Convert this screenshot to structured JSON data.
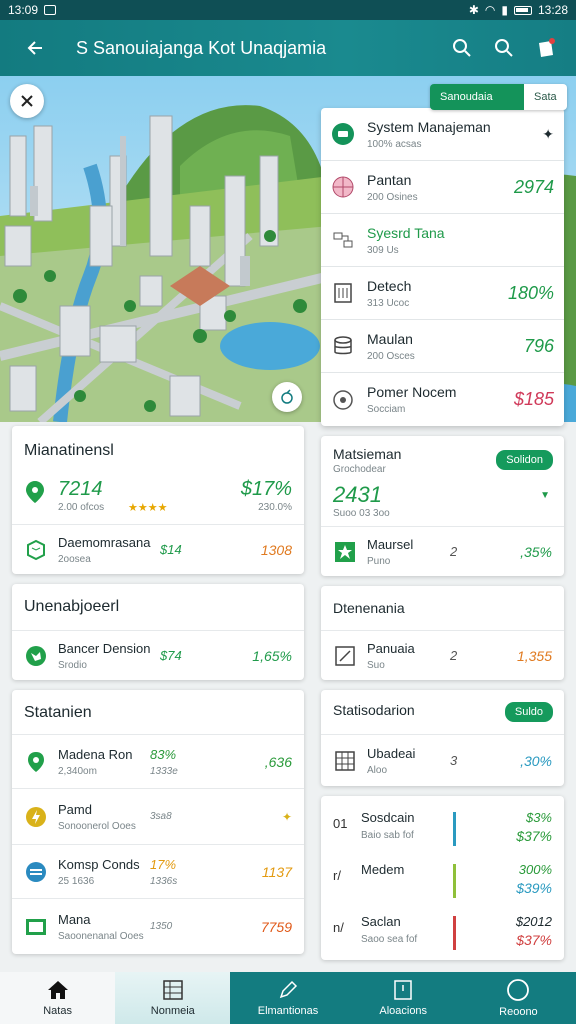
{
  "status": {
    "time": "13:09",
    "time_right": "13:28"
  },
  "appbar": {
    "title": "S Sanouiajanga Kot Unaqjamia"
  },
  "map": {
    "toggle_on": "Sanoudaia",
    "toggle_off": "Sata"
  },
  "side_panel": {
    "header": {
      "title": "System Manajeman",
      "sub": "100% acsas"
    },
    "items": [
      {
        "label": "Pantan",
        "sub": "200 Osines",
        "value": "2974",
        "color": "#1f9a4a"
      },
      {
        "label": "Syesrd Tana",
        "sub": "309 Us",
        "value": "",
        "color": "#1f9a4a"
      },
      {
        "label": "Detech",
        "sub": "313 Ucoc",
        "value": "180%",
        "color": "#1f9a4a"
      },
      {
        "label": "Maulan",
        "sub": "200 Osces",
        "value": "796",
        "color": "#1f9a4a"
      },
      {
        "label": "Pomer Nocem",
        "sub": "Socciam",
        "value": "$185",
        "color": "#d03a5a"
      }
    ]
  },
  "card_management": {
    "title": "Mianatinensl",
    "top": {
      "value": "7214",
      "sub": "2.00 ofcos",
      "right_value": "$17%",
      "right_sub": "230.0%"
    },
    "row": {
      "label": "Daemomrasana",
      "sub": "2oosea",
      "mid": "$14",
      "value": "1308"
    }
  },
  "card_matsieman": {
    "title": "Matsieman",
    "sub": "Grochodear",
    "pill": "Solidon",
    "big_value": "2431",
    "big_sub": "Suoo 03 3oo",
    "row": {
      "label": "Maursel",
      "sub": "Puno",
      "mid": "2",
      "value": ",35%"
    }
  },
  "card_unenab": {
    "title": "Unenabjoeerl",
    "row": {
      "label": "Bancer Dension",
      "sub": "Srodio",
      "mid": "$74",
      "value": "1,65%"
    }
  },
  "card_dtenenania": {
    "title": "Dtenenania",
    "row": {
      "label": "Panuaia",
      "sub": "Suo",
      "mid": "2",
      "value": "1,355"
    }
  },
  "card_statanien": {
    "title": "Statanien",
    "rows": [
      {
        "label": "Madena Ron",
        "sub": "2,340om",
        "mid": "83%",
        "mid_sub": "1333e",
        "value": ",636",
        "mid_color": "#2a9a3a",
        "value_color": "#2a9a3a"
      },
      {
        "label": "Pamd",
        "sub": "Sonoonerol Ooes",
        "mid": "",
        "mid_sub": "3sa8",
        "value": "",
        "mid_color": "#7a8589",
        "value_color": "#7a8589"
      },
      {
        "label": "Komsp Conds",
        "sub": "25 1636",
        "mid": "17%",
        "mid_sub": "1336s",
        "value": "1137",
        "mid_color": "#e39a10",
        "value_color": "#e39a10"
      },
      {
        "label": "Mana",
        "sub": "Saoonenanal Ooes",
        "mid": "",
        "mid_sub": "1350",
        "value": "7759",
        "mid_color": "#7a8589",
        "value_color": "#e05a1a"
      }
    ]
  },
  "card_statisodarion": {
    "title": "Statisodarion",
    "pill": "Suldo",
    "row": {
      "label": "Ubadeai",
      "sub": "Aloo",
      "mid": "3",
      "value": ",30%"
    }
  },
  "card_rank": {
    "rows": [
      {
        "num": "01",
        "label": "Sosdcain",
        "sub": "Baio sab fof",
        "v1": "$3%",
        "v2": "$37%",
        "c1": "#2a9a3a",
        "c2": "#2a9a3a",
        "bar": "#2a9ac0"
      },
      {
        "num": "r/",
        "label": "Medem",
        "sub": "",
        "v1": "300%",
        "v2": "$39%",
        "c1": "#2a9a3a",
        "c2": "#2a9ac0",
        "bar": "#8fc03a"
      },
      {
        "num": "n/",
        "label": "Saclan",
        "sub": "Saoo sea fof",
        "v1": "$2012",
        "v2": "$37%",
        "c1": "#1d2a2f",
        "c2": "#d04040",
        "bar": "#d04040"
      }
    ]
  },
  "bottom_nav": [
    {
      "label": "Natas"
    },
    {
      "label": "Nonmeia"
    },
    {
      "label": "Elmantionas"
    },
    {
      "label": "Aloacions"
    },
    {
      "label": "Reoono"
    }
  ]
}
